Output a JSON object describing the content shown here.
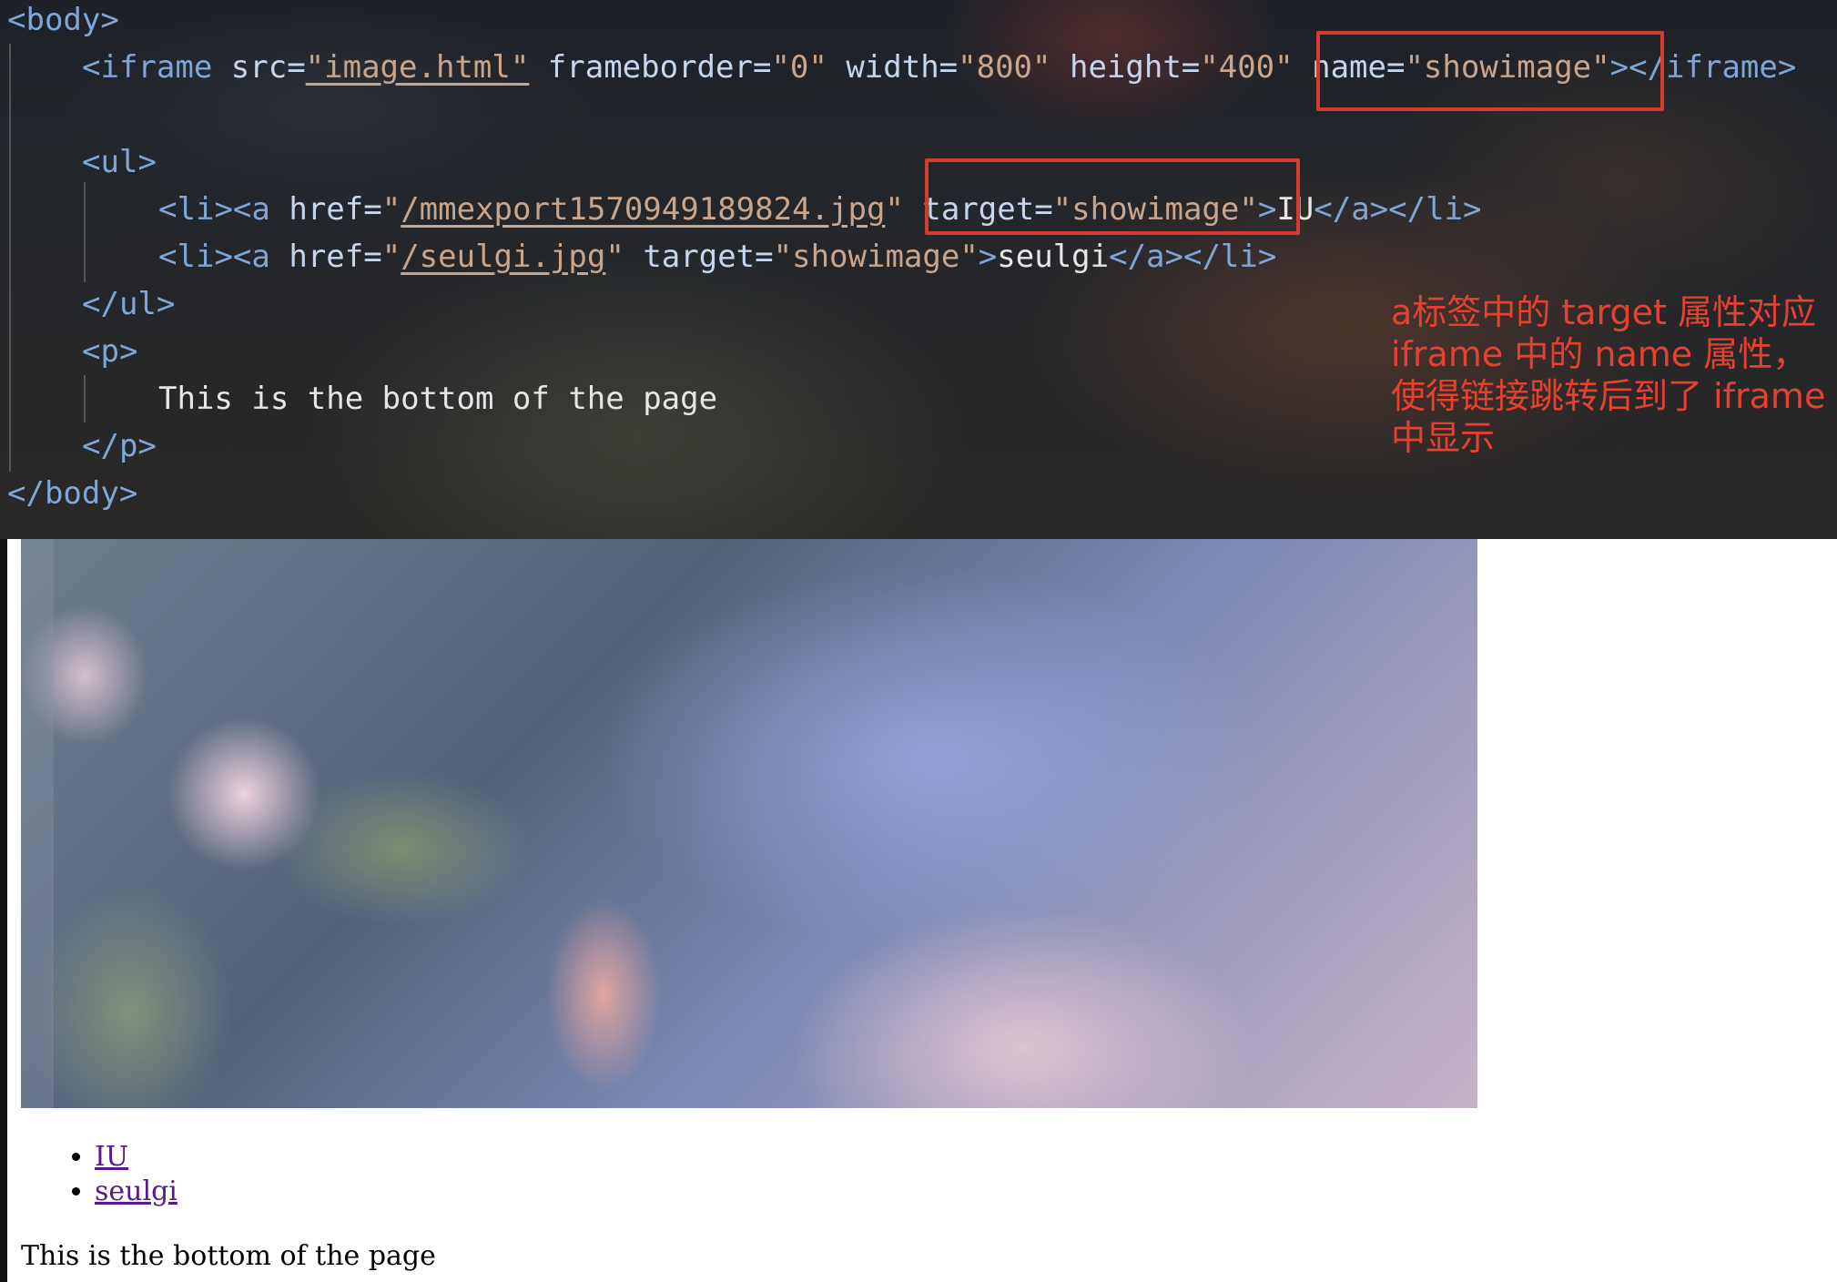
{
  "editor": {
    "lines": {
      "body_open": {
        "lt": "<",
        "tag": "body",
        "gt": ">"
      },
      "iframe": {
        "lt": "<",
        "tag": "iframe",
        "a1": " src=",
        "v1": "\"image.html\"",
        "a2": " frameborder=",
        "v2": "\"0\"",
        "a3": " width=",
        "v3": "\"800\"",
        "a4": " height=",
        "v4": "\"400\"",
        "a5": " name=",
        "v5": "\"showimage\"",
        "gt": ">",
        "close": "</iframe>"
      },
      "ul_open": {
        "lt": "<",
        "tag": "ul",
        "gt": ">"
      },
      "li1": {
        "lt": "<",
        "tag": "li",
        "gt": ">",
        "lt2": "<",
        "tag2": "a",
        "a1": " href=",
        "q1": "\"",
        "v1": "/mmexport1570949189824.jpg",
        "q2": "\"",
        "a2": " target=",
        "v2": "\"showimage\"",
        "gt2": ">",
        "text": "IU",
        "close": "</a></li>"
      },
      "li2": {
        "lt": "<",
        "tag": "li",
        "gt": ">",
        "lt2": "<",
        "tag2": "a",
        "a1": " href=",
        "q1": "\"",
        "v1": "/seulgi.jpg",
        "q2": "\"",
        "a2": " target=",
        "v2": "\"showimage\"",
        "gt2": ">",
        "text": "seulgi",
        "close": "</a></li>"
      },
      "ul_close": {
        "tag": "</ul>"
      },
      "p_open": {
        "lt": "<",
        "tag": "p",
        "gt": ">"
      },
      "p_text": "This is the bottom of the page",
      "p_close": {
        "tag": "</p>"
      },
      "body_close": {
        "tag": "</body>"
      }
    },
    "annotation": "a标签中的 target 属性对应 iframe 中的 name 属性，使得链接跳转后到了 iframe 中显示",
    "highlight_color": "#d63a2c"
  },
  "page": {
    "links": [
      "IU",
      "seulgi"
    ],
    "bottom_text": "This is the bottom of the page"
  }
}
